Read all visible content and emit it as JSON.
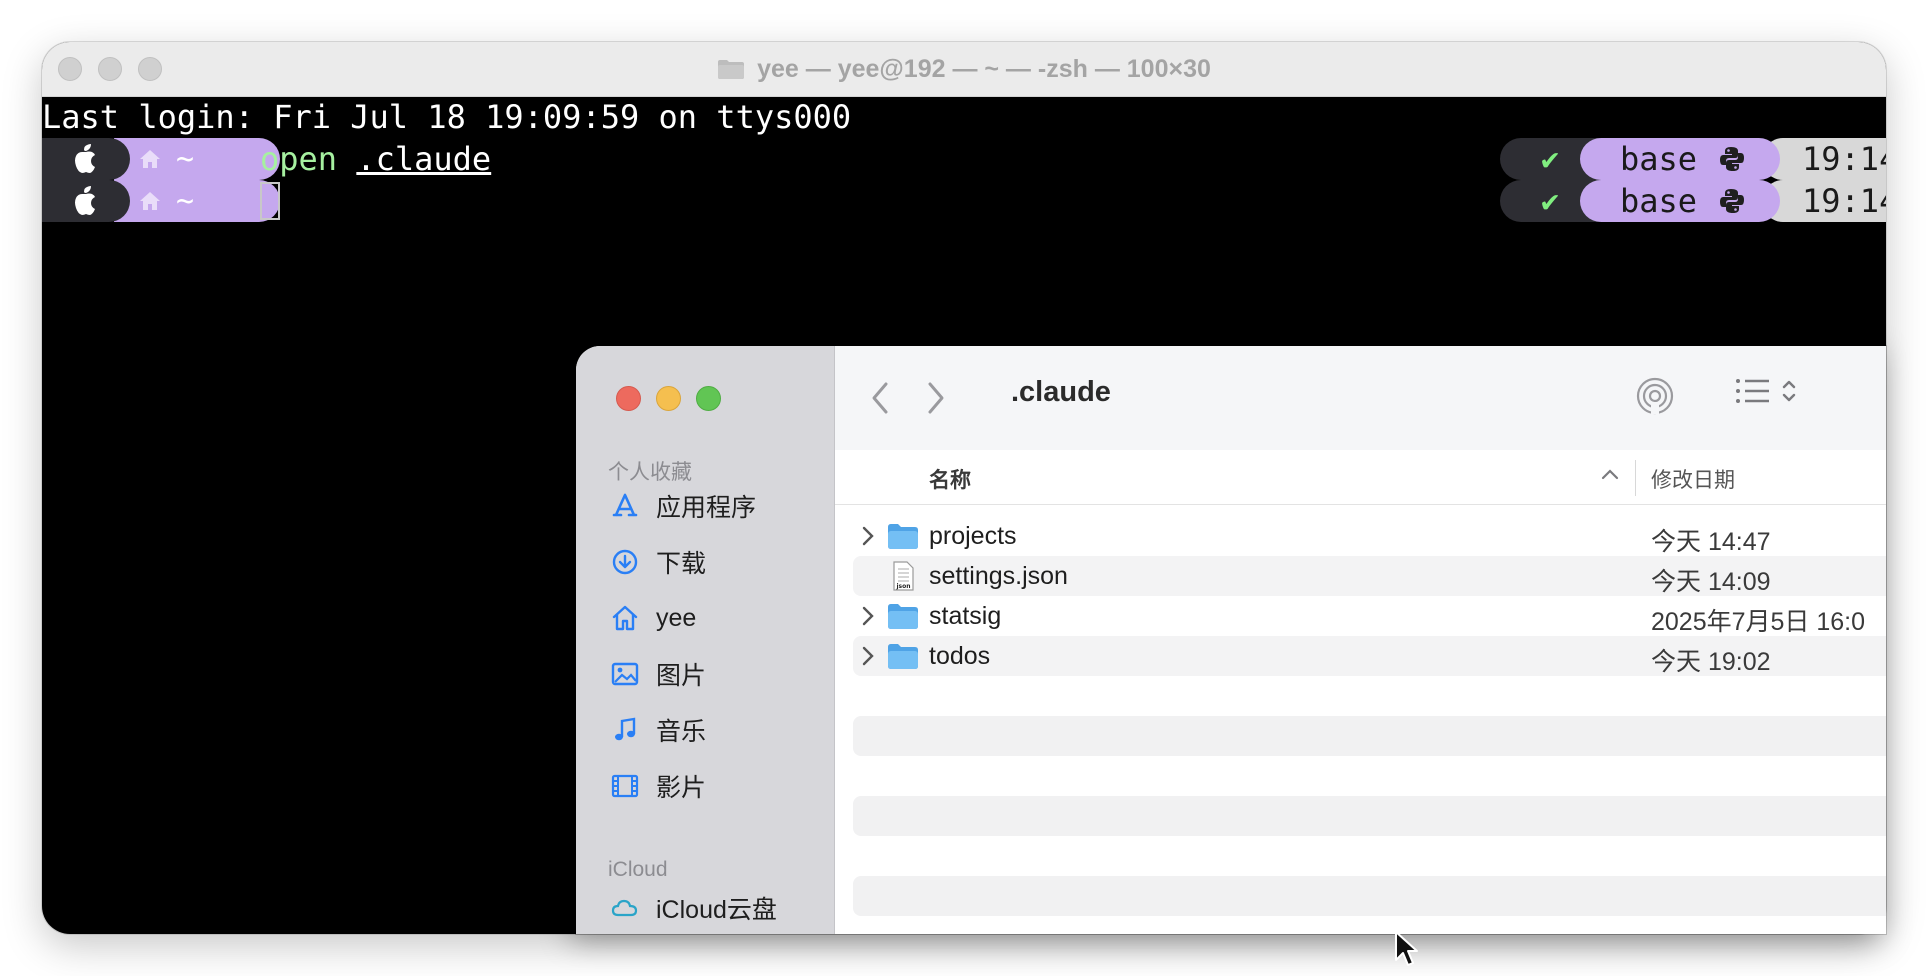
{
  "terminal": {
    "title": "yee — yee@192 — ~ — -zsh — 100×30",
    "last_login": "Last login: Fri Jul 18 19:09:59 on ttys000",
    "prompt_dir": "~",
    "command_name": "open",
    "command_arg": ".claude",
    "status_check": "✔",
    "env_name": "base",
    "time_fragment": "19:14"
  },
  "finder": {
    "folder_title": ".claude",
    "sidebar": {
      "favorites_header": "个人收藏",
      "items": [
        {
          "label": "应用程序",
          "icon": "applications-icon"
        },
        {
          "label": "下载",
          "icon": "downloads-icon"
        },
        {
          "label": "yee",
          "icon": "home-icon"
        },
        {
          "label": "图片",
          "icon": "pictures-icon"
        },
        {
          "label": "音乐",
          "icon": "music-icon"
        },
        {
          "label": "影片",
          "icon": "movies-icon"
        }
      ],
      "icloud_header": "iCloud",
      "icloud_item": {
        "label": "iCloud云盘",
        "icon": "icloud-drive-icon"
      }
    },
    "columns": {
      "name": "名称",
      "date": "修改日期"
    },
    "files": [
      {
        "name": "projects",
        "date": "今天 14:47",
        "kind": "folder"
      },
      {
        "name": "settings.json",
        "date": "今天 14:09",
        "kind": "json"
      },
      {
        "name": "statsig",
        "date": "2025年7月5日 16:0",
        "kind": "folder"
      },
      {
        "name": "todos",
        "date": "今天 19:02",
        "kind": "folder"
      }
    ],
    "colors": {
      "accent_folder": "#6cb6ef",
      "close": "#ed6a5e",
      "minimize": "#f5bf4f",
      "zoom": "#61c554"
    }
  }
}
